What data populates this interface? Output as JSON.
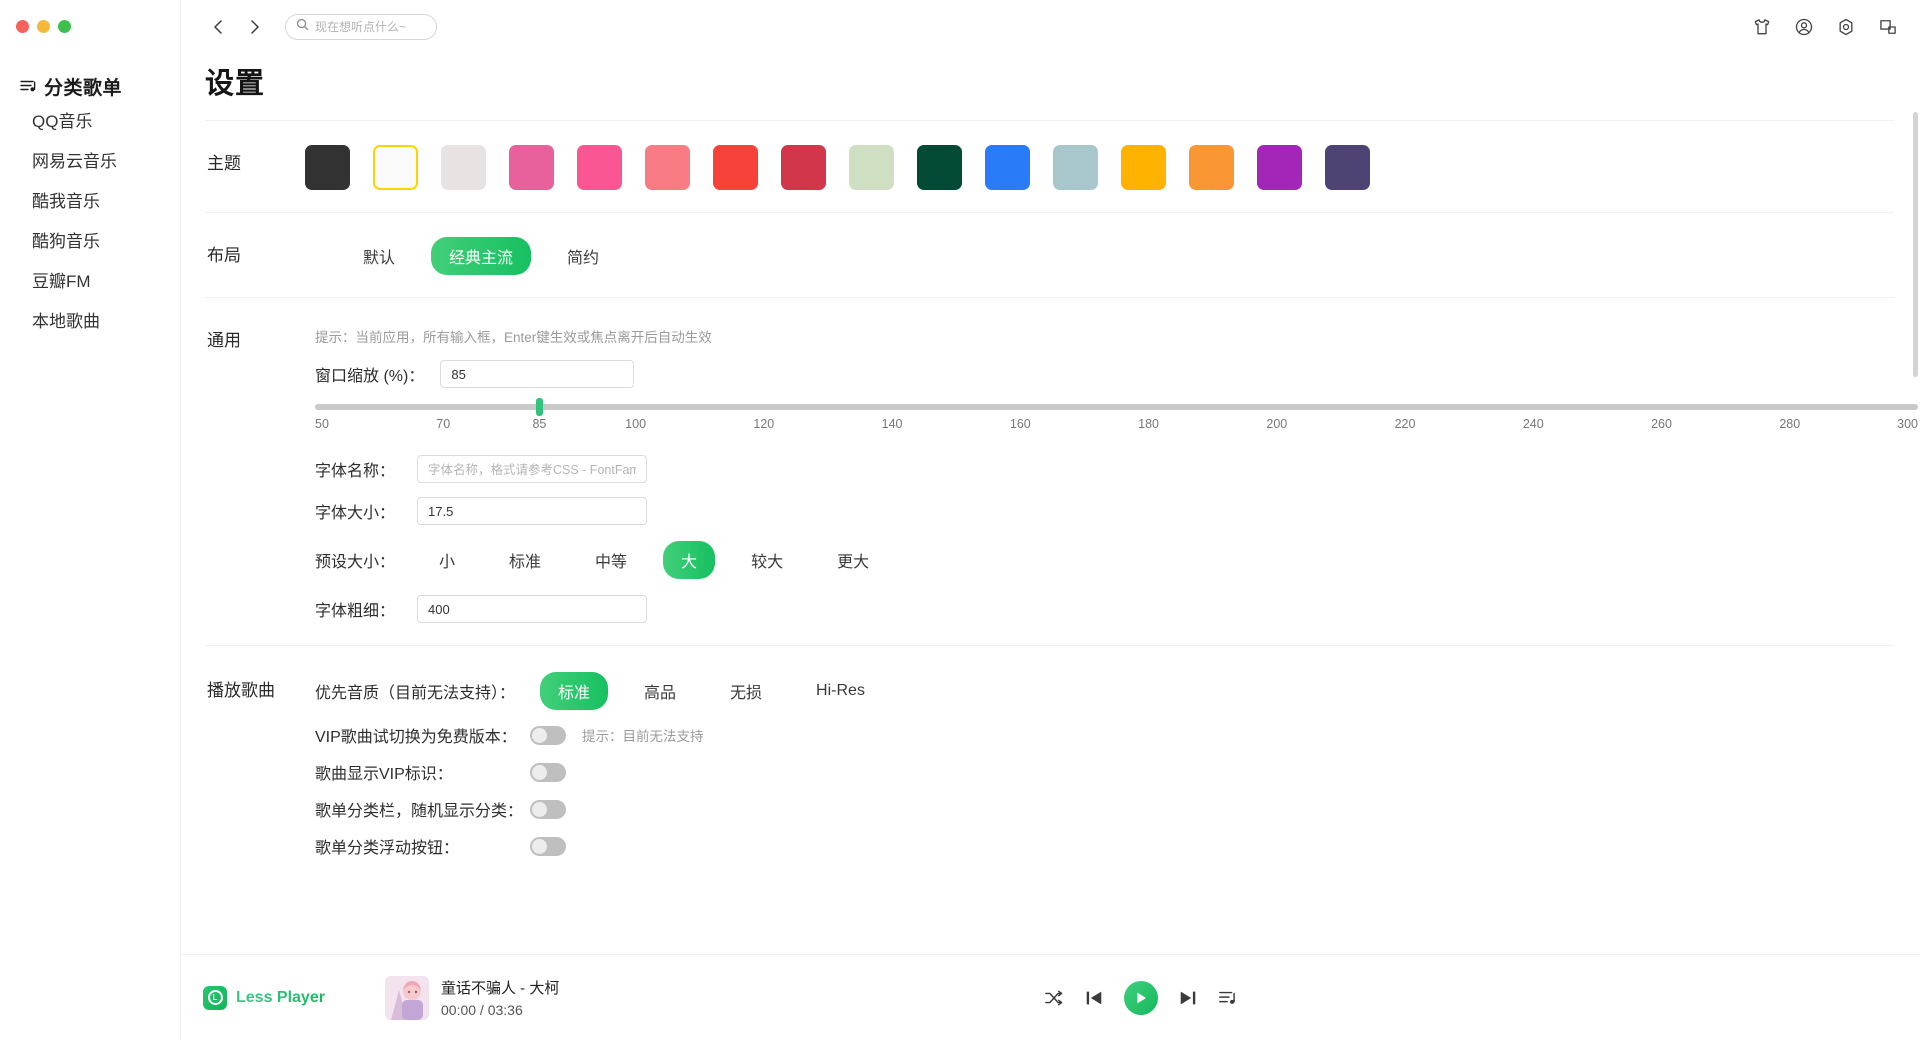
{
  "window": {
    "traffic_lights": [
      "close",
      "minimize",
      "maximize"
    ]
  },
  "sidebar": {
    "header": "分类歌单",
    "items": [
      {
        "label": "QQ音乐"
      },
      {
        "label": "网易云音乐"
      },
      {
        "label": "酷我音乐"
      },
      {
        "label": "酷狗音乐"
      },
      {
        "label": "豆瓣FM"
      },
      {
        "label": "本地歌曲"
      }
    ]
  },
  "topbar": {
    "back": "‹",
    "forward": "›",
    "search_placeholder": "现在想听点什么~",
    "search_value": "",
    "icons": [
      "tshirt-icon",
      "user-account-icon",
      "settings-icon",
      "window-mode-icon"
    ]
  },
  "page": {
    "title": "设置"
  },
  "theme": {
    "label": "主题",
    "selected_index": 1,
    "colors": [
      "#323232",
      "#fafafa",
      "#e8e2e3",
      "#e8619d",
      "#fa5694",
      "#f97b83",
      "#f7423a",
      "#d1364a",
      "#cfdfc2",
      "#034a36",
      "#2a7bf7",
      "#a8c7cd",
      "#ffb200",
      "#fb9634",
      "#a426b8",
      "#4e4372"
    ]
  },
  "layout": {
    "label": "布局",
    "options": [
      "默认",
      "经典主流",
      "简约"
    ],
    "selected": "经典主流"
  },
  "general": {
    "label": "通用",
    "hint": "提示：当前应用，所有输入框，Enter键生效或焦点离开后自动生效",
    "window_scale": {
      "label": "窗口缩放 (%)：",
      "value": "85",
      "slider_min": 50,
      "slider_max": 300,
      "slider_value": 85,
      "ticks": [
        50,
        70,
        85,
        100,
        120,
        140,
        160,
        180,
        200,
        220,
        240,
        260,
        280,
        300
      ]
    },
    "font_family": {
      "label": "字体名称：",
      "value": "",
      "placeholder": "字体名称，格式请参考CSS - FontFamily"
    },
    "font_size": {
      "label": "字体大小：",
      "value": "17.5"
    },
    "preset_size": {
      "label": "预设大小：",
      "options": [
        "小",
        "标准",
        "中等",
        "大",
        "较大",
        "更大"
      ],
      "selected": "大"
    },
    "font_weight": {
      "label": "字体粗细：",
      "value": "400"
    }
  },
  "playback": {
    "label": "播放歌曲",
    "quality": {
      "label": "优先音质（目前无法支持）：",
      "options": [
        "标准",
        "高品",
        "无损",
        "Hi-Res"
      ],
      "selected": "标准"
    },
    "toggles": [
      {
        "label": "VIP歌曲试切换为免费版本：",
        "on": false,
        "hint": "提示：目前无法支持"
      },
      {
        "label": "歌曲显示VIP标识：",
        "on": false,
        "hint": ""
      },
      {
        "label": "歌单分类栏，随机显示分类：",
        "on": false,
        "hint": ""
      },
      {
        "label": "歌单分类浮动按钮：",
        "on": false,
        "hint": ""
      }
    ]
  },
  "player": {
    "brand": "Less Player",
    "brand_mark": "L",
    "track_title": "童话不骗人 - 大柯",
    "track_time": "00:00 / 03:36",
    "controls": [
      "shuffle-icon",
      "previous-icon",
      "play-icon",
      "next-icon",
      "playlist-icon"
    ],
    "right_controls": [
      "volume-icon",
      "heart-icon",
      "equalizer-icon"
    ]
  }
}
